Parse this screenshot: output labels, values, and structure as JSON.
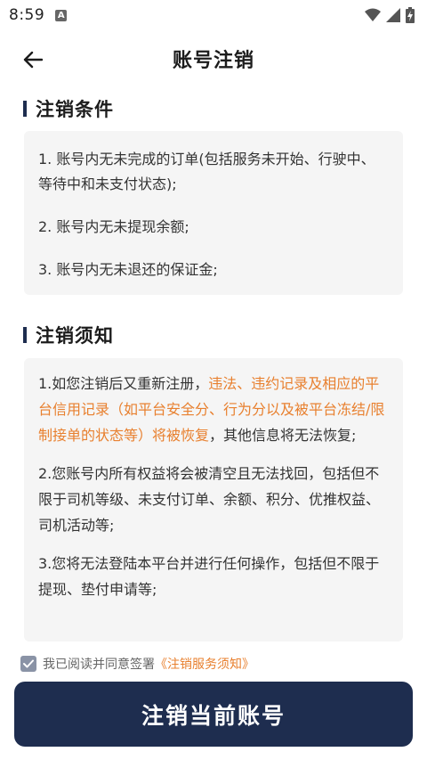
{
  "status_bar": {
    "time": "8:59",
    "notification_letter": "A",
    "icons": [
      "wifi-icon",
      "signal-icon",
      "battery-charging-icon"
    ]
  },
  "header": {
    "title": "账号注销",
    "back_icon": "arrow-left-icon"
  },
  "conditions": {
    "title": "注销条件",
    "items": [
      "1. 账号内无未完成的订单(包括服务未开始、行驶中、等待中和未支付状态);",
      "2. 账号内无未提现余额;",
      "3. 账号内无未退还的保证金;"
    ]
  },
  "notice": {
    "title": "注销须知",
    "item1_pre": "1.如您注销后又重新注册，",
    "item1_highlight": "违法、违约记录及相应的平台信用记录（如平台安全分、行为分以及被平台冻结/限制接单的状态等）将被恢复",
    "item1_post": "，其他信息将无法恢复;",
    "item2": "2.您账号内所有权益将会被清空且无法找回，包括但不限于司机等级、未支付订单、余额、积分、优推权益、司机活动等;",
    "item3": "3.您将无法登陆本平台并进行任何操作，包括但不限于提现、垫付申请等;"
  },
  "agreement": {
    "checked": true,
    "text": "我已阅读并同意签署",
    "link": "《注销服务须知》"
  },
  "submit": {
    "label": "注销当前账号"
  },
  "colors": {
    "primary": "#1e2d4f",
    "highlight": "#e8802f",
    "card_bg": "#f5f5f5"
  }
}
